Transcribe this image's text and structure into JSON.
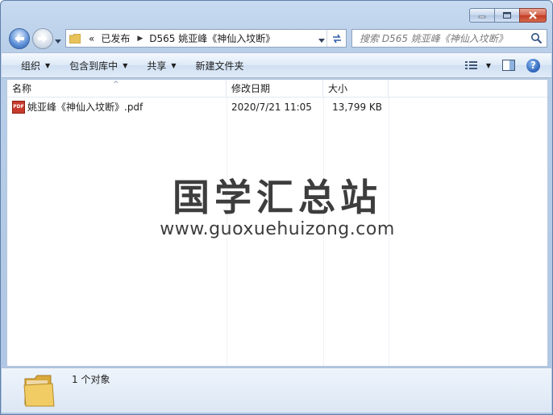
{
  "window": {
    "minimize_label": "minimize",
    "maximize_label": "maximize",
    "close_label": "close"
  },
  "address": {
    "overflow": "«",
    "crumbs": [
      "已发布",
      "D565 姚亚峰《神仙入坟断》"
    ]
  },
  "search": {
    "placeholder": "搜索 D565 姚亚峰《神仙入坟断》"
  },
  "toolbar": {
    "organize": "组织",
    "include_in_library": "包含到库中",
    "share": "共享",
    "new_folder": "新建文件夹"
  },
  "columns": {
    "name": "名称",
    "date_modified": "修改日期",
    "size": "大小"
  },
  "files": [
    {
      "name": "姚亚峰《神仙入坟断》.pdf",
      "date_modified": "2020/7/21 11:05",
      "size": "13,799 KB",
      "icon": "pdf-icon"
    }
  ],
  "watermark": {
    "title": "国学汇总站",
    "url": "www.guoxuehuizong.com"
  },
  "details": {
    "item_count": "1 个对象"
  },
  "icons": {
    "pdf_badge": "PDF"
  },
  "colors": {
    "frame": "#b9cfe9",
    "close_button": "#c33d22",
    "pdf_icon": "#c73b2d"
  }
}
